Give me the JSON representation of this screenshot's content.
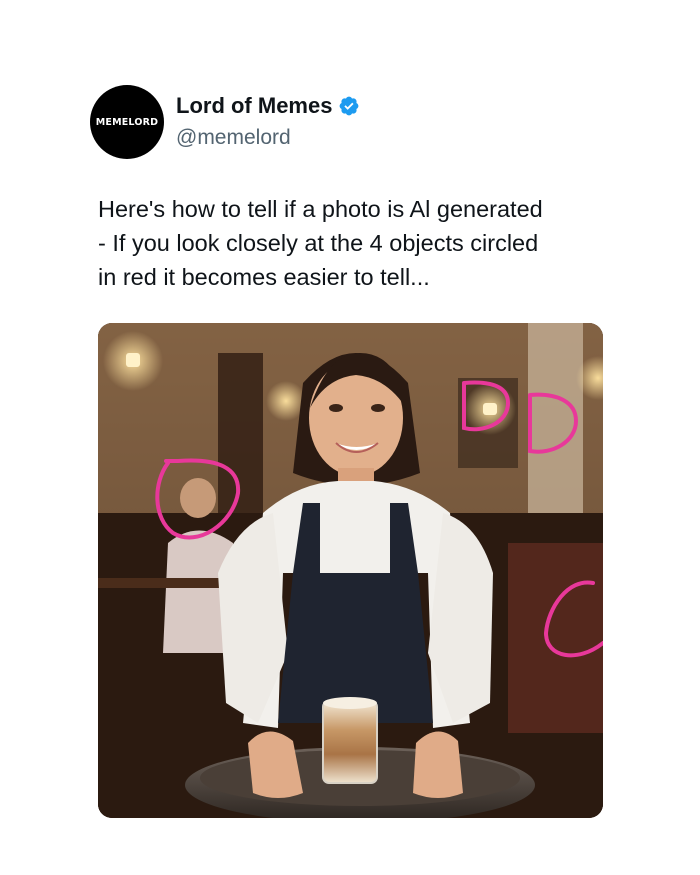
{
  "account": {
    "avatar_text": "MEMELORD",
    "display_name": "Lord of Memes",
    "handle": "@memelord",
    "verified_color": "#1d9bf0"
  },
  "tweet": {
    "lines": [
      "Here's how to tell if a photo is Al generated",
      "- If you look closely at the 4 objects circled",
      "in red it becomes easier to tell..."
    ]
  },
  "media": {
    "description_icon": "photo",
    "annotation_color": "#e8389a",
    "annotation_count": 4
  }
}
